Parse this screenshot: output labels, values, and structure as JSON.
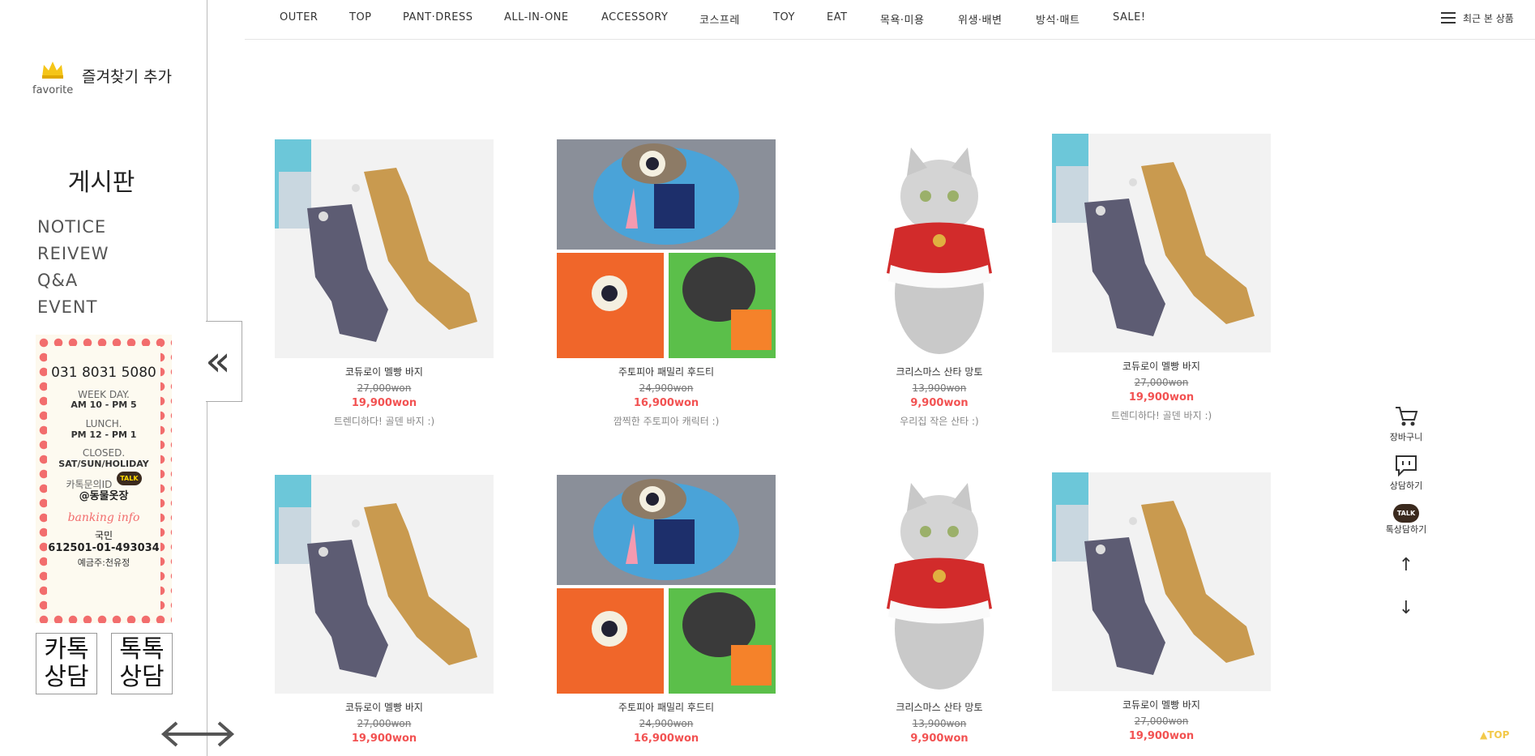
{
  "nav": {
    "items": [
      "OUTER",
      "TOP",
      "PANT·DRESS",
      "ALL-IN-ONE",
      "ACCESSORY",
      "코스프레",
      "TOY",
      "EAT",
      "목욕·미용",
      "위생·배변",
      "방석·매트",
      "SALE!"
    ],
    "recent_label": "최근 본 상품"
  },
  "sidebar": {
    "favorite_sub": "favorite",
    "favorite_label": "즐겨찾기 추가",
    "board_title": "게시판",
    "board_links": [
      "NOTICE",
      "REIVEW",
      "Q&A",
      "EVENT"
    ],
    "info": {
      "phone": "031 8031 5080",
      "weekday_label": "WEEK DAY.",
      "weekday_hours": "AM 10 - PM 5",
      "lunch_label": "LUNCH.",
      "lunch_hours": "PM 12 - PM 1",
      "closed_label": "CLOSED.",
      "closed_days": "SAT/SUN/HOLIDAY",
      "kakao_label": "카톡문의ID",
      "talk_badge": "TALK",
      "kakao_id": "@동물옷장",
      "bank_title": "banking info",
      "bank_name": "국민",
      "bank_account": "612501-01-493034",
      "bank_holder": "예금주:천유정"
    },
    "kakao_button": [
      "카톡",
      "상담"
    ],
    "talktalk_button": [
      "톡톡",
      "상담"
    ]
  },
  "products": [
    {
      "name": "코듀로이 멜빵 바지",
      "original_price": "27,000won",
      "sale_price": "19,900won",
      "desc": "트렌디하다! 골덴 바지 :)",
      "image": "overalls"
    },
    {
      "name": "주토피아 패밀리 후드티",
      "original_price": "24,900won",
      "sale_price": "16,900won",
      "desc": "깜찍한 주토피아 캐릭터 :)",
      "image": "zootopia"
    },
    {
      "name": "크리스마스 산타 망토",
      "original_price": "13,900won",
      "sale_price": "9,900won",
      "desc": "우리집 작은 산타 :)",
      "image": "cat"
    },
    {
      "name": "코듀로이 멜빵 바지",
      "original_price": "27,000won",
      "sale_price": "19,900won",
      "desc": "트렌디하다! 골덴 바지 :)",
      "image": "overalls"
    },
    {
      "name": "코듀로이 멜빵 바지",
      "original_price": "27,000won",
      "sale_price": "19,900won",
      "desc": "",
      "image": "overalls"
    },
    {
      "name": "주토피아 패밀리 후드티",
      "original_price": "24,900won",
      "sale_price": "16,900won",
      "desc": "",
      "image": "zootopia"
    },
    {
      "name": "크리스마스 산타 망토",
      "original_price": "13,900won",
      "sale_price": "9,900won",
      "desc": "",
      "image": "cat"
    },
    {
      "name": "코듀로이 멜빵 바지",
      "original_price": "27,000won",
      "sale_price": "19,900won",
      "desc": "",
      "image": "overalls"
    }
  ],
  "quick_menu": {
    "cart": "장바구니",
    "consult": "상담하기",
    "talktalk": "톡상담하기",
    "talk_badge": "TALK"
  },
  "top_label": "TOP",
  "colors": {
    "sale": "#f25252",
    "dots": "#f26d6d",
    "kakao": "#3b2a1e",
    "crown": "#f5c518"
  }
}
